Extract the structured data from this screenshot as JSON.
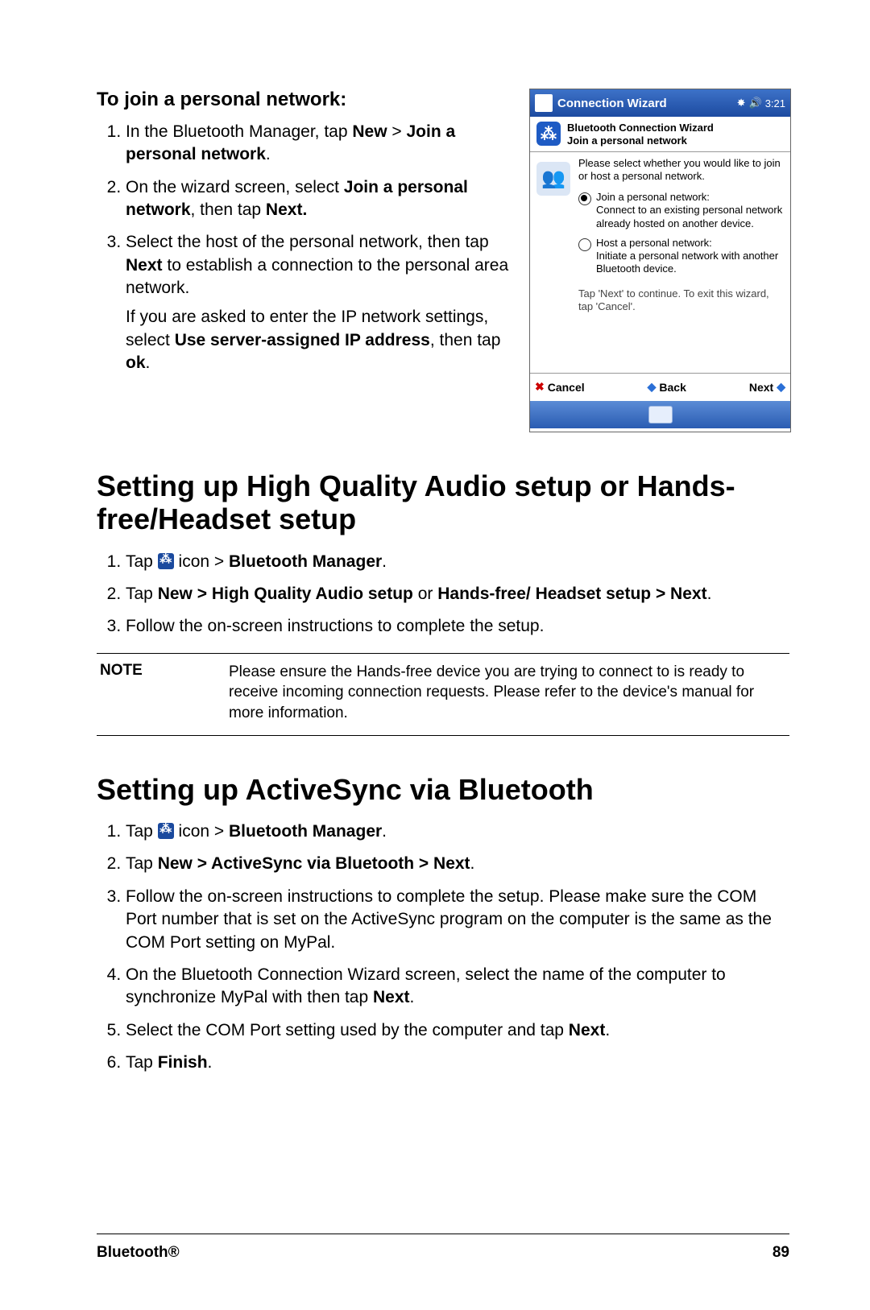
{
  "section1": {
    "heading": "To join a personal network:",
    "steps": [
      {
        "pre": "In the Bluetooth Manager, tap ",
        "b1": "New",
        "mid": " > ",
        "b2": "Join a personal network",
        "post": "."
      },
      {
        "pre": "On the wizard screen, select ",
        "b1": "Join a personal network",
        "mid": ", then tap ",
        "b2": "Next.",
        "post": ""
      },
      {
        "pre": "Select the host of the personal network, then tap ",
        "b1": "Next",
        "mid": " to establish a connection to the personal area network.",
        "b2": "",
        "post": ""
      }
    ],
    "extra": {
      "pre": "If you are asked to enter the IP network settings, select ",
      "b1": "Use server-assigned IP address",
      "mid": ", then tap ",
      "b2": "ok",
      "post": "."
    }
  },
  "screenshot": {
    "titlebar": "Connection Wizard",
    "time": "3:21",
    "header_line1": "Bluetooth Connection Wizard",
    "header_line2": "Join a personal network",
    "prompt": "Please select whether you would like to join or host a personal network.",
    "opt1_title": "Join a personal network:",
    "opt1_desc": "Connect to an existing personal network already hosted on another device.",
    "opt2_title": "Host a personal network:",
    "opt2_desc": "Initiate a personal network with another Bluetooth device.",
    "hint": "Tap 'Next' to continue. To exit this wizard, tap 'Cancel'.",
    "btn_cancel": "Cancel",
    "btn_back": "Back",
    "btn_next": "Next"
  },
  "section2": {
    "heading": "Setting up High Quality Audio setup or Hands-free/Headset setup",
    "step1_pre": "Tap ",
    "step1_mid": " icon > ",
    "step1_b": "Bluetooth Manager",
    "step1_post": ".",
    "step2_pre": "Tap ",
    "step2_b1": "New > High Quality Audio setup",
    "step2_mid": " or ",
    "step2_b2": "Hands-free/ Headset setup > Next",
    "step2_post": ".",
    "step3": "Follow the on-screen instructions to complete the setup."
  },
  "note": {
    "label": "NOTE",
    "text": "Please ensure the Hands-free device you are trying to connect to is ready to receive incoming connection requests. Please refer to the device's manual for more information."
  },
  "section3": {
    "heading": "Setting up ActiveSync via Bluetooth",
    "step1_pre": "Tap ",
    "step1_mid": " icon > ",
    "step1_b": "Bluetooth Manager",
    "step1_post": ".",
    "step2_pre": "Tap ",
    "step2_b": "New > ActiveSync via Bluetooth > Next",
    "step2_post": ".",
    "step3": "Follow the on-screen instructions to complete the setup. Please make sure the COM Port number that is set on the ActiveSync program on the computer is the same as the COM Port setting on MyPal.",
    "step4_pre": "On the Bluetooth Connection Wizard screen, select the name of the computer to synchronize MyPal with then tap ",
    "step4_b": "Next",
    "step4_post": ".",
    "step5_pre": "Select the COM Port setting used by the computer and tap ",
    "step5_b": "Next",
    "step5_post": ".",
    "step6_pre": "Tap ",
    "step6_b": "Finish",
    "step6_post": "."
  },
  "footer": {
    "left": "Bluetooth®",
    "right": "89"
  }
}
